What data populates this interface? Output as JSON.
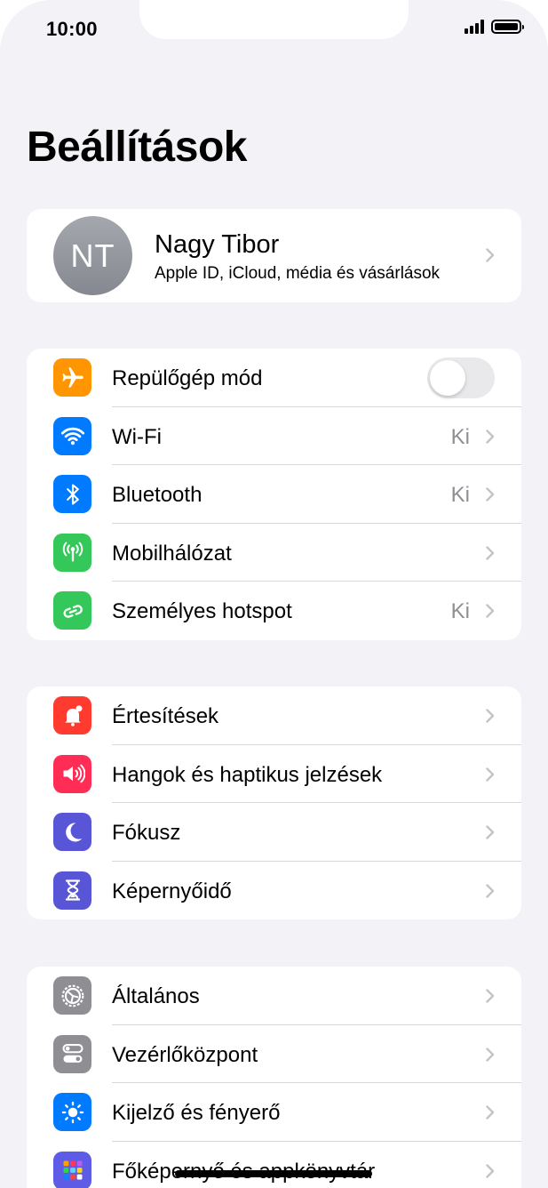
{
  "status_bar": {
    "time": "10:00"
  },
  "page": {
    "title": "Beállítások"
  },
  "profile": {
    "initials": "NT",
    "name": "Nagy Tibor",
    "subtitle": "Apple ID, iCloud, média és vásárlások"
  },
  "groups": [
    {
      "items": [
        {
          "label": "Repülőgép mód",
          "icon": "airplane-icon",
          "color": "#ff9500",
          "toggle": "off"
        },
        {
          "label": "Wi-Fi",
          "icon": "wifi-icon",
          "color": "#007aff",
          "value": "Ki"
        },
        {
          "label": "Bluetooth",
          "icon": "bluetooth-icon",
          "color": "#007aff",
          "value": "Ki"
        },
        {
          "label": "Mobilhálózat",
          "icon": "antenna-icon",
          "color": "#34c759"
        },
        {
          "label": "Személyes hotspot",
          "icon": "hotspot-link-icon",
          "color": "#34c759",
          "value": "Ki"
        }
      ]
    },
    {
      "items": [
        {
          "label": "Értesítések",
          "icon": "bell-icon",
          "color": "#ff3b30"
        },
        {
          "label": "Hangok és haptikus jelzések",
          "icon": "speaker-icon",
          "color": "#ff2d55"
        },
        {
          "label": "Fókusz",
          "icon": "moon-icon",
          "color": "#5856d6"
        },
        {
          "label": "Képernyőidő",
          "icon": "hourglass-icon",
          "color": "#5856d6"
        }
      ]
    },
    {
      "items": [
        {
          "label": "Általános",
          "icon": "gear-icon",
          "color": "#8e8e93"
        },
        {
          "label": "Vezérlőközpont",
          "icon": "switches-icon",
          "color": "#8e8e93"
        },
        {
          "label": "Kijelző és fényerő",
          "icon": "sun-icon",
          "color": "#007aff"
        },
        {
          "label": "Főképernyő és appkönyvtár",
          "icon": "app-grid-icon",
          "color": "#5e5ce6"
        }
      ]
    }
  ]
}
